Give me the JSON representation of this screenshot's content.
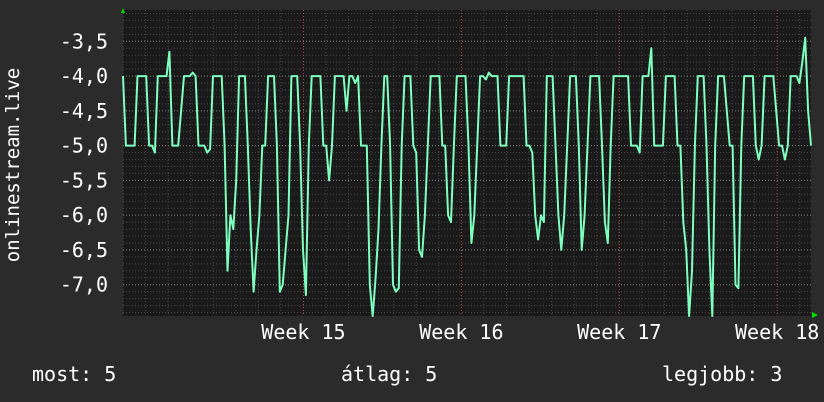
{
  "chart_data": {
    "type": "line",
    "title": "",
    "ylabel": "onlinestream.live",
    "xlabel": "",
    "ylim": [
      -7.45,
      -3.05
    ],
    "y_ticks": [
      -3.5,
      -4.0,
      -4.5,
      -5.0,
      -5.5,
      -6.0,
      -6.5,
      -7.0
    ],
    "y_tick_labels": [
      "-3,5",
      "-4,0",
      "-4,5",
      "-5,0",
      "-5,5",
      "-6,0",
      "-6,5",
      "-7,0"
    ],
    "x_ticks": [
      {
        "label": "Week 15",
        "x": 64
      },
      {
        "label": "Week 16",
        "x": 120
      },
      {
        "label": "Week 17",
        "x": 176
      },
      {
        "label": "Week 18",
        "x": 232
      }
    ],
    "xlim": [
      0,
      244
    ],
    "grid": true,
    "colors": {
      "line": "#7fffbf",
      "grid": "#6a6a6a",
      "vgrid_major": "#b04040",
      "axis_arrow": "#00dd00",
      "plot_bg": "#1a1a1a",
      "page_bg": "#2b2b2b"
    },
    "series": [
      {
        "values": [
          -4.0,
          -5.0,
          -5.0,
          -5.0,
          -5.0,
          -4.0,
          -4.0,
          -4.0,
          -4.0,
          -5.0,
          -5.0,
          -5.1,
          -4.0,
          -4.0,
          -4.0,
          -4.0,
          -3.65,
          -5.0,
          -5.0,
          -5.0,
          -4.5,
          -4.0,
          -4.0,
          -4.0,
          -3.95,
          -4.0,
          -5.0,
          -5.0,
          -5.0,
          -5.1,
          -5.05,
          -4.0,
          -4.0,
          -4.0,
          -4.0,
          -5.0,
          -6.8,
          -6.0,
          -6.2,
          -5.5,
          -4.0,
          -4.0,
          -4.0,
          -5.0,
          -6.2,
          -7.1,
          -6.5,
          -6.0,
          -5.0,
          -5.0,
          -4.0,
          -4.0,
          -4.0,
          -5.0,
          -7.1,
          -7.0,
          -6.5,
          -6.0,
          -4.0,
          -4.0,
          -4.0,
          -5.0,
          -6.5,
          -7.15,
          -5.0,
          -4.0,
          -4.0,
          -4.0,
          -4.0,
          -5.0,
          -5.0,
          -5.5,
          -5.0,
          -4.0,
          -4.0,
          -4.0,
          -4.0,
          -4.5,
          -4.0,
          -4.0,
          -4.1,
          -4.0,
          -5.0,
          -5.0,
          -5.0,
          -7.0,
          -7.45,
          -6.9,
          -6.2,
          -5.0,
          -4.0,
          -4.0,
          -5.0,
          -7.0,
          -7.1,
          -7.05,
          -5.0,
          -4.0,
          -4.0,
          -4.0,
          -5.0,
          -5.1,
          -6.5,
          -6.6,
          -6.0,
          -5.0,
          -4.0,
          -4.0,
          -4.0,
          -4.0,
          -5.0,
          -5.0,
          -6.0,
          -6.1,
          -5.0,
          -4.0,
          -4.0,
          -4.0,
          -4.0,
          -5.0,
          -6.4,
          -6.0,
          -5.0,
          -4.0,
          -4.0,
          -4.05,
          -3.95,
          -4.0,
          -4.0,
          -4.0,
          -5.0,
          -5.0,
          -5.0,
          -4.0,
          -4.0,
          -4.0,
          -4.0,
          -4.0,
          -4.0,
          -5.0,
          -5.0,
          -5.1,
          -6.0,
          -6.35,
          -6.0,
          -6.1,
          -4.0,
          -4.0,
          -4.0,
          -5.0,
          -6.0,
          -6.5,
          -6.0,
          -5.0,
          -4.0,
          -4.0,
          -4.0,
          -5.0,
          -6.5,
          -6.0,
          -5.0,
          -4.0,
          -4.0,
          -4.0,
          -4.0,
          -5.0,
          -6.1,
          -6.4,
          -5.0,
          -4.0,
          -4.0,
          -4.0,
          -4.0,
          -4.0,
          -4.0,
          -5.0,
          -5.0,
          -5.0,
          -5.1,
          -4.0,
          -4.0,
          -4.0,
          -3.6,
          -5.0,
          -5.0,
          -5.0,
          -5.0,
          -4.0,
          -4.0,
          -4.0,
          -4.0,
          -5.0,
          -5.0,
          -6.1,
          -6.5,
          -7.45,
          -6.8,
          -5.0,
          -4.0,
          -4.0,
          -4.0,
          -5.0,
          -6.5,
          -7.45,
          -5.0,
          -4.0,
          -4.0,
          -4.0,
          -4.5,
          -5.0,
          -5.0,
          -7.0,
          -7.05,
          -5.0,
          -4.0,
          -4.0,
          -4.0,
          -4.0,
          -5.0,
          -5.2,
          -5.0,
          -4.0,
          -4.0,
          -4.0,
          -4.0,
          -4.5,
          -5.0,
          -5.0,
          -5.2,
          -5.0,
          -4.0,
          -4.0,
          -4.0,
          -4.1,
          -3.8,
          -3.45,
          -4.5,
          -5.0
        ]
      }
    ]
  },
  "footer": {
    "now": "most: 5",
    "avg": "átlag: 5",
    "best": "legjobb: 3"
  }
}
